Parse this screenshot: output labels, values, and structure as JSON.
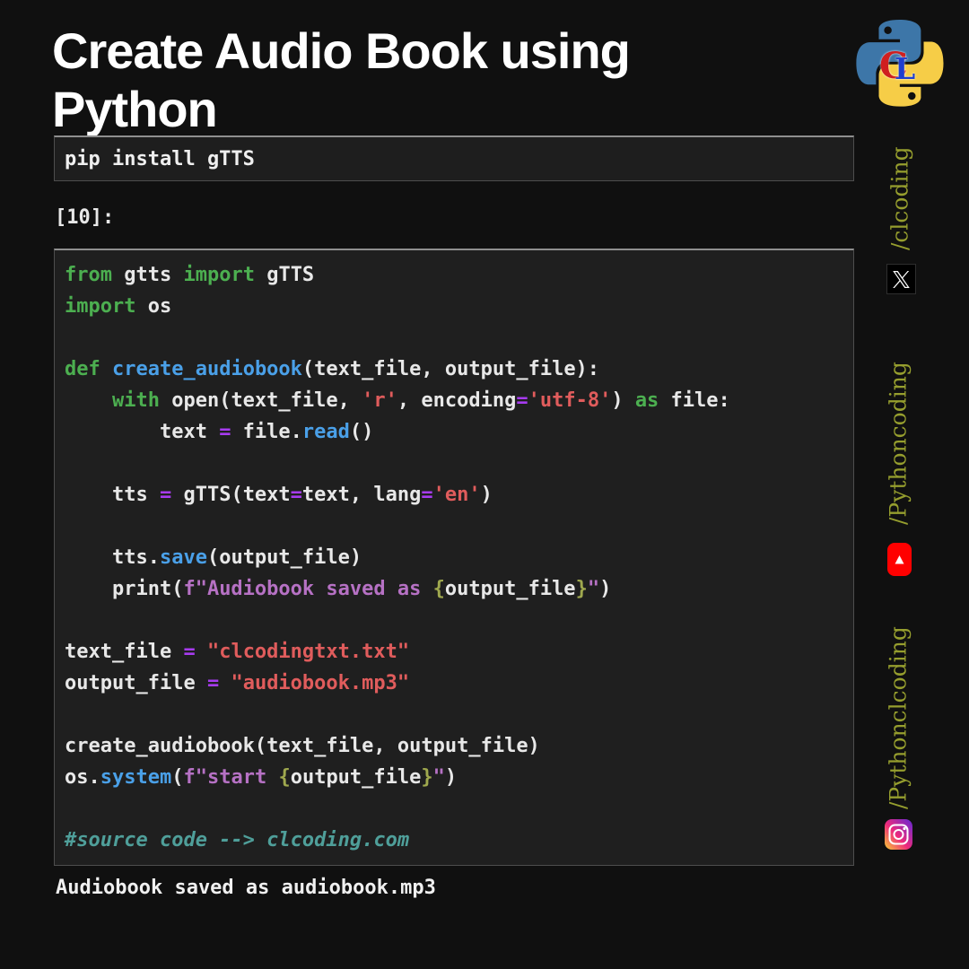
{
  "header": {
    "title": "Create Audio Book using Python",
    "logo_icon": "python-logo",
    "badge": {
      "c_letter": "C",
      "l_letter": "L"
    }
  },
  "pip_cell": {
    "text": "pip install gTTS"
  },
  "cell_label": "[10]:",
  "code_cell": {
    "language": "python",
    "lines": [
      [
        {
          "t": "from",
          "s": "kw"
        },
        {
          "t": " gtts ",
          "s": "tx"
        },
        {
          "t": "import",
          "s": "kw"
        },
        {
          "t": " gTTS",
          "s": "tx"
        }
      ],
      [
        {
          "t": "import",
          "s": "kw"
        },
        {
          "t": " os",
          "s": "tx"
        }
      ],
      [],
      [
        {
          "t": "def",
          "s": "kw"
        },
        {
          "t": " ",
          "s": "tx"
        },
        {
          "t": "create_audiobook",
          "s": "fn"
        },
        {
          "t": "(text_file, output_file):",
          "s": "tx"
        }
      ],
      [
        {
          "t": "    ",
          "s": "tx"
        },
        {
          "t": "with",
          "s": "kw"
        },
        {
          "t": " open(text_file, ",
          "s": "tx"
        },
        {
          "t": "'r'",
          "s": "str"
        },
        {
          "t": ", encoding",
          "s": "tx"
        },
        {
          "t": "=",
          "s": "op"
        },
        {
          "t": "'utf-8'",
          "s": "str"
        },
        {
          "t": ") ",
          "s": "tx"
        },
        {
          "t": "as",
          "s": "kw"
        },
        {
          "t": " file:",
          "s": "tx"
        }
      ],
      [
        {
          "t": "        text ",
          "s": "tx"
        },
        {
          "t": "=",
          "s": "op"
        },
        {
          "t": " file.",
          "s": "tx"
        },
        {
          "t": "read",
          "s": "fn"
        },
        {
          "t": "()",
          "s": "tx"
        }
      ],
      [],
      [
        {
          "t": "    tts ",
          "s": "tx"
        },
        {
          "t": "=",
          "s": "op"
        },
        {
          "t": " gTTS(text",
          "s": "tx"
        },
        {
          "t": "=",
          "s": "op"
        },
        {
          "t": "text, lang",
          "s": "tx"
        },
        {
          "t": "=",
          "s": "op"
        },
        {
          "t": "'en'",
          "s": "str"
        },
        {
          "t": ")",
          "s": "tx"
        }
      ],
      [],
      [
        {
          "t": "    tts.",
          "s": "tx"
        },
        {
          "t": "save",
          "s": "fn"
        },
        {
          "t": "(output_file)",
          "s": "tx"
        }
      ],
      [
        {
          "t": "    print(",
          "s": "tx"
        },
        {
          "t": "f\"Audiobook saved as ",
          "s": "fstr"
        },
        {
          "t": "{",
          "s": "brace"
        },
        {
          "t": "output_file",
          "s": "tx"
        },
        {
          "t": "}",
          "s": "brace"
        },
        {
          "t": "\"",
          "s": "fstr"
        },
        {
          "t": ")",
          "s": "tx"
        }
      ],
      [],
      [
        {
          "t": "text_file ",
          "s": "tx"
        },
        {
          "t": "=",
          "s": "op"
        },
        {
          "t": " ",
          "s": "tx"
        },
        {
          "t": "\"clcodingtxt.txt\"",
          "s": "str"
        }
      ],
      [
        {
          "t": "output_file ",
          "s": "tx"
        },
        {
          "t": "=",
          "s": "op"
        },
        {
          "t": " ",
          "s": "tx"
        },
        {
          "t": "\"audiobook.mp3\"",
          "s": "str"
        }
      ],
      [],
      [
        {
          "t": "create_audiobook(text_file, output_file)",
          "s": "tx"
        }
      ],
      [
        {
          "t": "os.",
          "s": "tx"
        },
        {
          "t": "system",
          "s": "fn"
        },
        {
          "t": "(",
          "s": "tx"
        },
        {
          "t": "f\"start ",
          "s": "fstr"
        },
        {
          "t": "{",
          "s": "brace"
        },
        {
          "t": "output_file",
          "s": "tx"
        },
        {
          "t": "}",
          "s": "brace"
        },
        {
          "t": "\"",
          "s": "fstr"
        },
        {
          "t": ")",
          "s": "tx"
        }
      ],
      [],
      [
        {
          "t": "#source code --> clcoding.com",
          "s": "cm"
        }
      ]
    ]
  },
  "output_text": "Audiobook saved as audiobook.mp3",
  "sidebar": {
    "groups": [
      {
        "handle": "/clcoding",
        "icon": "x-icon"
      },
      {
        "handle": "/Pythoncoding",
        "icon": "youtube-icon"
      },
      {
        "handle": "/Pythonclcoding",
        "icon": "instagram-icon"
      }
    ]
  },
  "colors": {
    "background": "#101010",
    "cell_background": "#1f1f1f",
    "cell_border": "#4e4e4e",
    "keyword_green": "#4caf50",
    "function_blue": "#4aa0e8",
    "operator_purple": "#a73bf0",
    "string_red": "#e05c5c",
    "fstring_purple": "#b671c4",
    "brace_olive": "#9fa84e",
    "comment_teal": "#4f9f9a",
    "sidebar_olive": "#969e2e",
    "python_blue": "#3d76a8",
    "python_yellow": "#f6cd47",
    "youtube_red": "#ff0000"
  }
}
